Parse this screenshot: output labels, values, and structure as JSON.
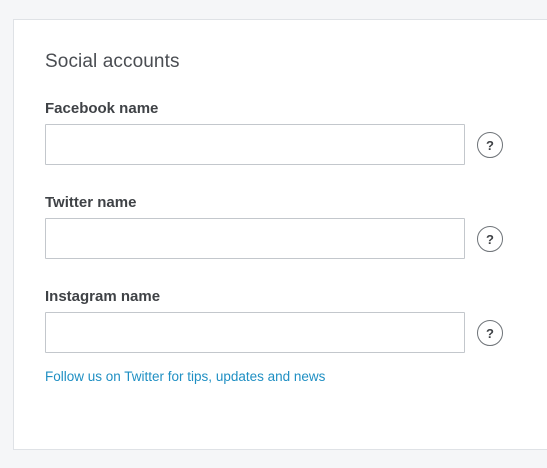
{
  "section": {
    "title": "Social accounts"
  },
  "fields": {
    "facebook": {
      "label": "Facebook name",
      "value": "",
      "help": "?"
    },
    "twitter": {
      "label": "Twitter name",
      "value": "",
      "help": "?"
    },
    "instagram": {
      "label": "Instagram name",
      "value": "",
      "help": "?"
    }
  },
  "footer": {
    "link_text": "Follow us on Twitter for tips, updates and news"
  },
  "colors": {
    "link": "#1f8fc3",
    "background": "#f5f6f8",
    "card": "#ffffff",
    "input_border": "#c3c7cc"
  }
}
